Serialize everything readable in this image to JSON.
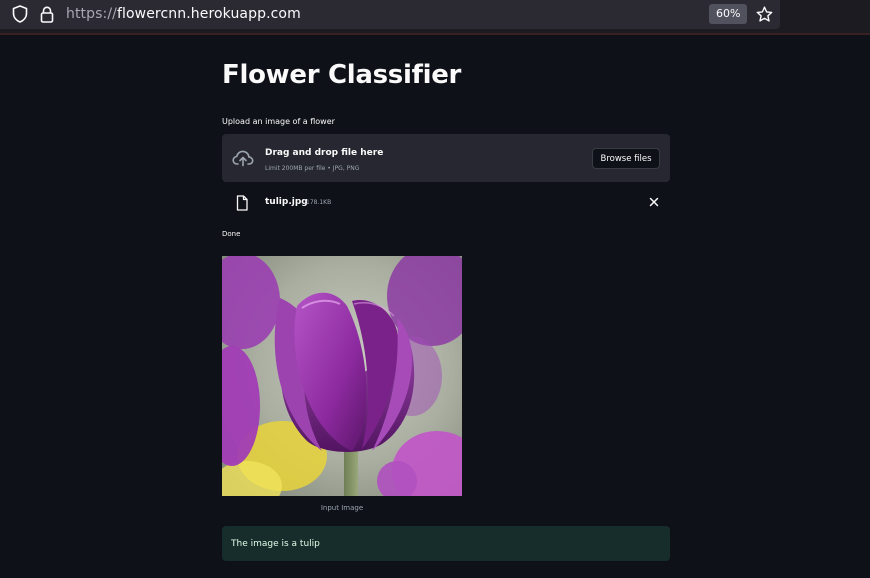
{
  "browser": {
    "url_protocol": "https://",
    "url_host": "flowercnn.herokuapp.com",
    "zoom": "60%"
  },
  "app": {
    "title": "Flower Classifier",
    "uploader": {
      "label": "Upload an image of a flower",
      "drop_text": "Drag and drop file here",
      "limit_text": "Limit 200MB per file • JPG, PNG",
      "browse_button": "Browse files"
    },
    "file": {
      "name": "tulip.jpg",
      "size": "178.1KB"
    },
    "status": "Done",
    "image_caption": "Input Image",
    "result": "The image is a tulip"
  },
  "colors": {
    "background": "#0e1117",
    "dropzone": "#262730",
    "success_bg": "#172d2b",
    "success_text": "#dffde9"
  }
}
